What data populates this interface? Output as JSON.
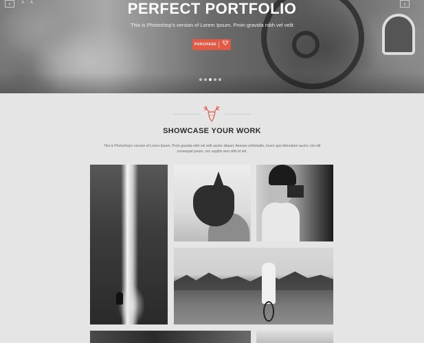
{
  "hero": {
    "title": "PERFECT PORTFOLIO",
    "subtitle": "This is Photoshop's version  of Lorem Ipsum. Proin gravida nibh vel velit",
    "purchase_label": "PURCHASE",
    "purchase_icon": "gem-icon",
    "prev_arrow": "‹",
    "next_arrow": "›",
    "top_left_tag": "⁚ A ⁚ A",
    "slider_dots": 5,
    "active_dot": 3
  },
  "section": {
    "icon": "deer-icon",
    "title": "SHOWCASE YOUR WORK",
    "description": "This is Photoshop's version  of Lorem Ipsum. Proin gravida nibh vel velit auctor aliquet. Aenean sollicitudin, lorem quis bibendum auctor, nisi elit consequat ipsum, nec sagittis sem nibh id elit."
  },
  "colors": {
    "accent": "#e25a45",
    "page_bg": "#e5e5e5",
    "title_text": "#2b2b2b"
  },
  "gallery": [
    {
      "name": "waterfall-photo"
    },
    {
      "name": "dog-photo"
    },
    {
      "name": "photographer-photo"
    },
    {
      "name": "bicycle-rider-photo"
    },
    {
      "name": "bottom-left-photo"
    },
    {
      "name": "bottom-right-photo"
    }
  ]
}
